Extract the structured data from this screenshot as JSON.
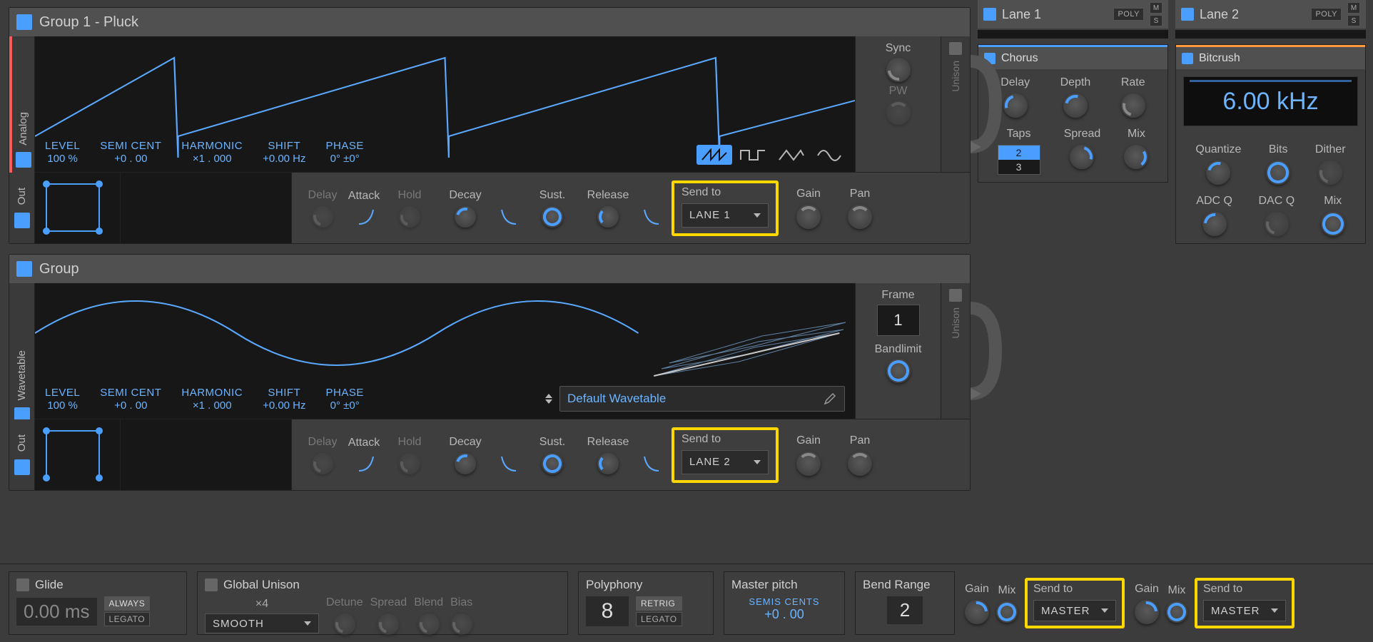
{
  "groups": [
    {
      "title": "Group 1 - Pluck",
      "osc_type": "Analog",
      "params": {
        "level_l": "LEVEL",
        "level_v": "100 %",
        "semi_l": "SEMI CENT",
        "semi_v": "+0 . 00",
        "harm_l": "HARMONIC",
        "harm_v": "×1 . 000",
        "shift_l": "SHIFT",
        "shift_v": "+0.00 Hz",
        "phase_l": "PHASE",
        "phase_v": "0°  ±0°"
      },
      "side": {
        "a": "Sync",
        "b": "PW"
      },
      "unison": "Unison",
      "out": {
        "delay": "Delay",
        "attack": "Attack",
        "hold": "Hold",
        "decay": "Decay",
        "sust": "Sust.",
        "release": "Release",
        "send": "Send to",
        "send_v": "LANE 1",
        "gain": "Gain",
        "pan": "Pan",
        "tab": "Out"
      }
    },
    {
      "title": "Group",
      "osc_type": "Wavetable",
      "params": {
        "level_l": "LEVEL",
        "level_v": "100 %",
        "semi_l": "SEMI CENT",
        "semi_v": "+0 . 00",
        "harm_l": "HARMONIC",
        "harm_v": "×1 . 000",
        "shift_l": "SHIFT",
        "shift_v": "+0.00 Hz",
        "phase_l": "PHASE",
        "phase_v": "0°  ±0°"
      },
      "side": {
        "a": "Frame",
        "frame": "1",
        "b": "Bandlimit"
      },
      "wt_name": "Default Wavetable",
      "unison": "Unison",
      "out": {
        "delay": "Delay",
        "attack": "Attack",
        "hold": "Hold",
        "decay": "Decay",
        "sust": "Sust.",
        "release": "Release",
        "send": "Send to",
        "send_v": "LANE 2",
        "gain": "Gain",
        "pan": "Pan",
        "tab": "Out"
      }
    }
  ],
  "lanes": [
    {
      "name": "Lane 1",
      "poly": "POLY",
      "m": "M",
      "s": "S",
      "fx": {
        "name": "Chorus",
        "row1": [
          "Delay",
          "Depth",
          "Rate"
        ],
        "row2_label": "Taps",
        "taps": [
          "2",
          "3"
        ],
        "row2": [
          "Spread",
          "Mix"
        ]
      },
      "out": {
        "gain": "Gain",
        "mix": "Mix",
        "send": "Send to",
        "dest": "MASTER"
      }
    },
    {
      "name": "Lane 2",
      "poly": "POLY",
      "m": "M",
      "s": "S",
      "fx": {
        "name": "Bitcrush",
        "lcd": "6.00 kHz",
        "row1": [
          "Quantize",
          "Bits",
          "Dither"
        ],
        "row2": [
          "ADC Q",
          "DAC Q",
          "Mix"
        ]
      },
      "out": {
        "gain": "Gain",
        "mix": "Mix",
        "send": "Send to",
        "dest": "MASTER"
      }
    }
  ],
  "footer": {
    "glide": {
      "title": "Glide",
      "value": "0.00 ms",
      "a": "ALWAYS",
      "b": "LEGATO"
    },
    "unison": {
      "title": "Global Unison",
      "mult": "×4",
      "mode": "SMOOTH",
      "knobs": [
        "Detune",
        "Spread",
        "Blend",
        "Bias"
      ]
    },
    "poly": {
      "title": "Polyphony",
      "value": "8",
      "a": "RETRIG",
      "b": "LEGATO"
    },
    "pitch": {
      "title": "Master pitch",
      "a": "SEMIS",
      "b": "CENTS",
      "value": "+0 . 00"
    },
    "bend": {
      "title": "Bend Range",
      "value": "2"
    }
  }
}
